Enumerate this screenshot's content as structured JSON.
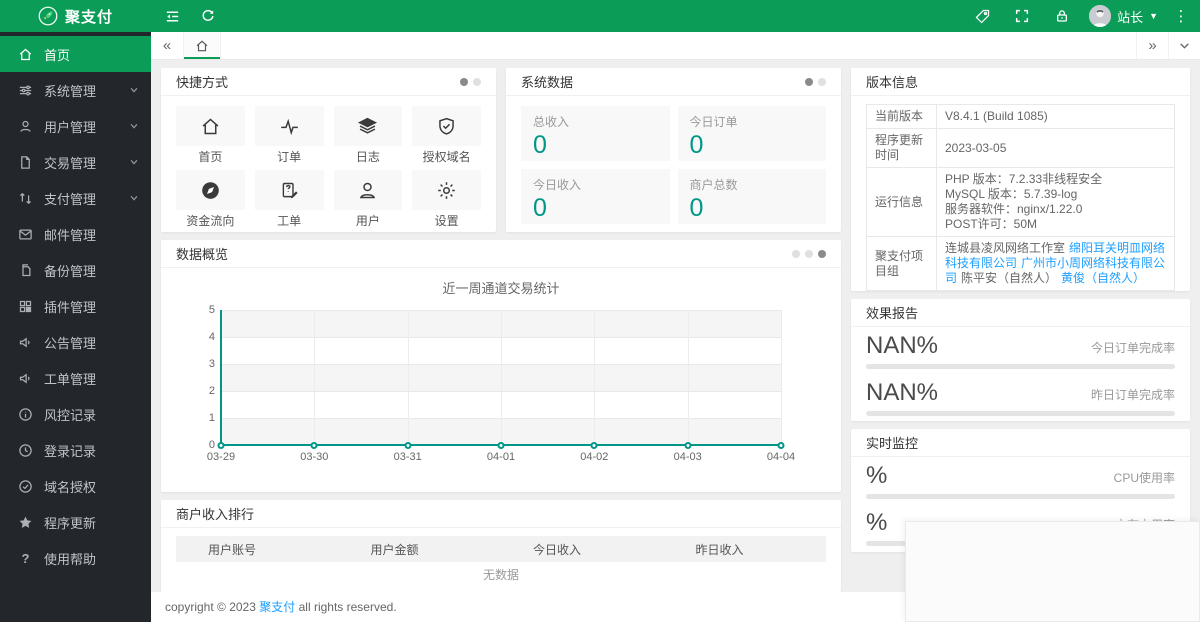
{
  "topbar": {
    "brand": "聚支付",
    "user_name": "站长"
  },
  "sidebar": {
    "items": [
      {
        "label": "首页"
      },
      {
        "label": "系统管理"
      },
      {
        "label": "用户管理"
      },
      {
        "label": "交易管理"
      },
      {
        "label": "支付管理"
      },
      {
        "label": "邮件管理"
      },
      {
        "label": "备份管理"
      },
      {
        "label": "插件管理"
      },
      {
        "label": "公告管理"
      },
      {
        "label": "工单管理"
      },
      {
        "label": "风控记录"
      },
      {
        "label": "登录记录"
      },
      {
        "label": "域名授权"
      },
      {
        "label": "程序更新"
      },
      {
        "label": "使用帮助"
      }
    ]
  },
  "quick": {
    "title": "快捷方式",
    "items": [
      {
        "label": "首页"
      },
      {
        "label": "订单"
      },
      {
        "label": "日志"
      },
      {
        "label": "授权域名"
      },
      {
        "label": "资金流向"
      },
      {
        "label": "工单"
      },
      {
        "label": "用户"
      },
      {
        "label": "设置"
      }
    ]
  },
  "system": {
    "title": "系统数据",
    "stats": [
      {
        "label": "总收入",
        "value": "0"
      },
      {
        "label": "今日订单",
        "value": "0"
      },
      {
        "label": "今日收入",
        "value": "0"
      },
      {
        "label": "商户总数",
        "value": "0"
      }
    ]
  },
  "version": {
    "title": "版本信息",
    "rows": {
      "current": {
        "label": "当前版本",
        "value": "V8.4.1 (Build 1085)"
      },
      "updated": {
        "label": "程序更新时间",
        "value": "2023-03-05"
      },
      "runtime": {
        "label": "运行信息",
        "lines": [
          "PHP 版本：7.2.33非线程安全",
          "MySQL 版本：5.7.39-log",
          "服务器软件：nginx/1.22.0",
          "POST许可：50M"
        ]
      },
      "team": {
        "label": "聚支付项目组",
        "members": [
          {
            "text": "连城县凌风网络工作室",
            "link": false
          },
          {
            "text": "绵阳耳关明皿网络科技有限公司",
            "link": true
          },
          {
            "text": "广州市小周网络科技有限公司",
            "link": true
          },
          {
            "text": "陈平安（自然人）",
            "link": false
          },
          {
            "text": "黄俊（自然人）",
            "link": true
          }
        ]
      }
    }
  },
  "overview": {
    "title": "数据概览"
  },
  "chart_data": {
    "type": "line",
    "title": "近一周通道交易统计",
    "x": [
      "03-29",
      "03-30",
      "03-31",
      "04-01",
      "04-02",
      "04-03",
      "04-04"
    ],
    "values": [
      0,
      0,
      0,
      0,
      0,
      0,
      0
    ],
    "ylim": [
      0,
      5
    ],
    "yticks": [
      "5",
      "4",
      "3",
      "2",
      "1",
      "0"
    ],
    "grid": true,
    "legend": "none",
    "line_color": "#009688"
  },
  "report": {
    "title": "效果报告",
    "items": [
      {
        "value": "NAN%",
        "label": "今日订单完成率"
      },
      {
        "value": "NAN%",
        "label": "昨日订单完成率"
      }
    ]
  },
  "monitor": {
    "title": "实时监控",
    "items": [
      {
        "value": "%",
        "label": "CPU使用率"
      },
      {
        "value": "%",
        "label": "内存占用率"
      }
    ]
  },
  "ranking": {
    "title": "商户收入排行",
    "columns": [
      "用户账号",
      "用户金额",
      "今日收入",
      "昨日收入"
    ],
    "empty": "无数据"
  },
  "footer": {
    "prefix": "copyright © 2023",
    "brand": "聚支付",
    "suffix": "all rights reserved."
  },
  "colors": {
    "topbar_green": "#0b9d58",
    "accent_teal": "#009688",
    "link_blue": "#1E9FFF",
    "sidebar_dark": "#23262b"
  }
}
